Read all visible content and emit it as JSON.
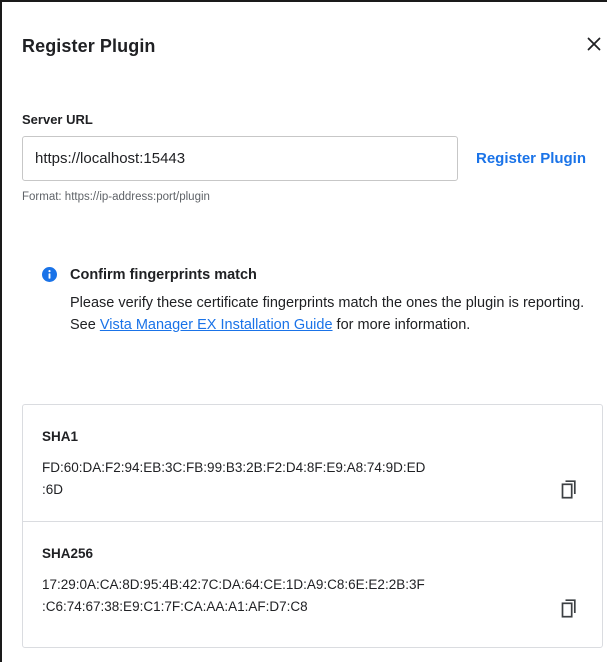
{
  "dialog": {
    "title": "Register Plugin",
    "close_icon": "close-icon"
  },
  "form": {
    "server_url_label": "Server URL",
    "server_url_value": "https://localhost:15443",
    "register_label": "Register Plugin",
    "format_hint": "Format: https://ip-address:port/plugin"
  },
  "notice": {
    "icon": "info-icon",
    "title": "Confirm fingerprints match",
    "body_before": "Please verify these certificate fingerprints match the ones the plugin is reporting. See ",
    "link_text": "Vista Manager EX Installation Guide",
    "body_after": " for more information."
  },
  "fingerprints": [
    {
      "name": "SHA1",
      "line1": "FD:60:DA:F2:94:EB:3C:FB:99:B3:2B:F2:D4:8F:E9:A8:74:9D:ED",
      "line2": ":6D",
      "copy_icon": "copy-icon"
    },
    {
      "name": "SHA256",
      "line1": "17:29:0A:CA:8D:95:4B:42:7C:DA:64:CE:1D:A9:C8:6E:E2:2B:3F",
      "line2": ":C6:74:67:38:E9:C1:7F:CA:AA:A1:AF:D7:C8",
      "copy_icon": "copy-icon"
    }
  ],
  "colors": {
    "accent": "#1a73e8",
    "text": "#202124",
    "muted": "#5f6368",
    "border": "#dadce0"
  }
}
